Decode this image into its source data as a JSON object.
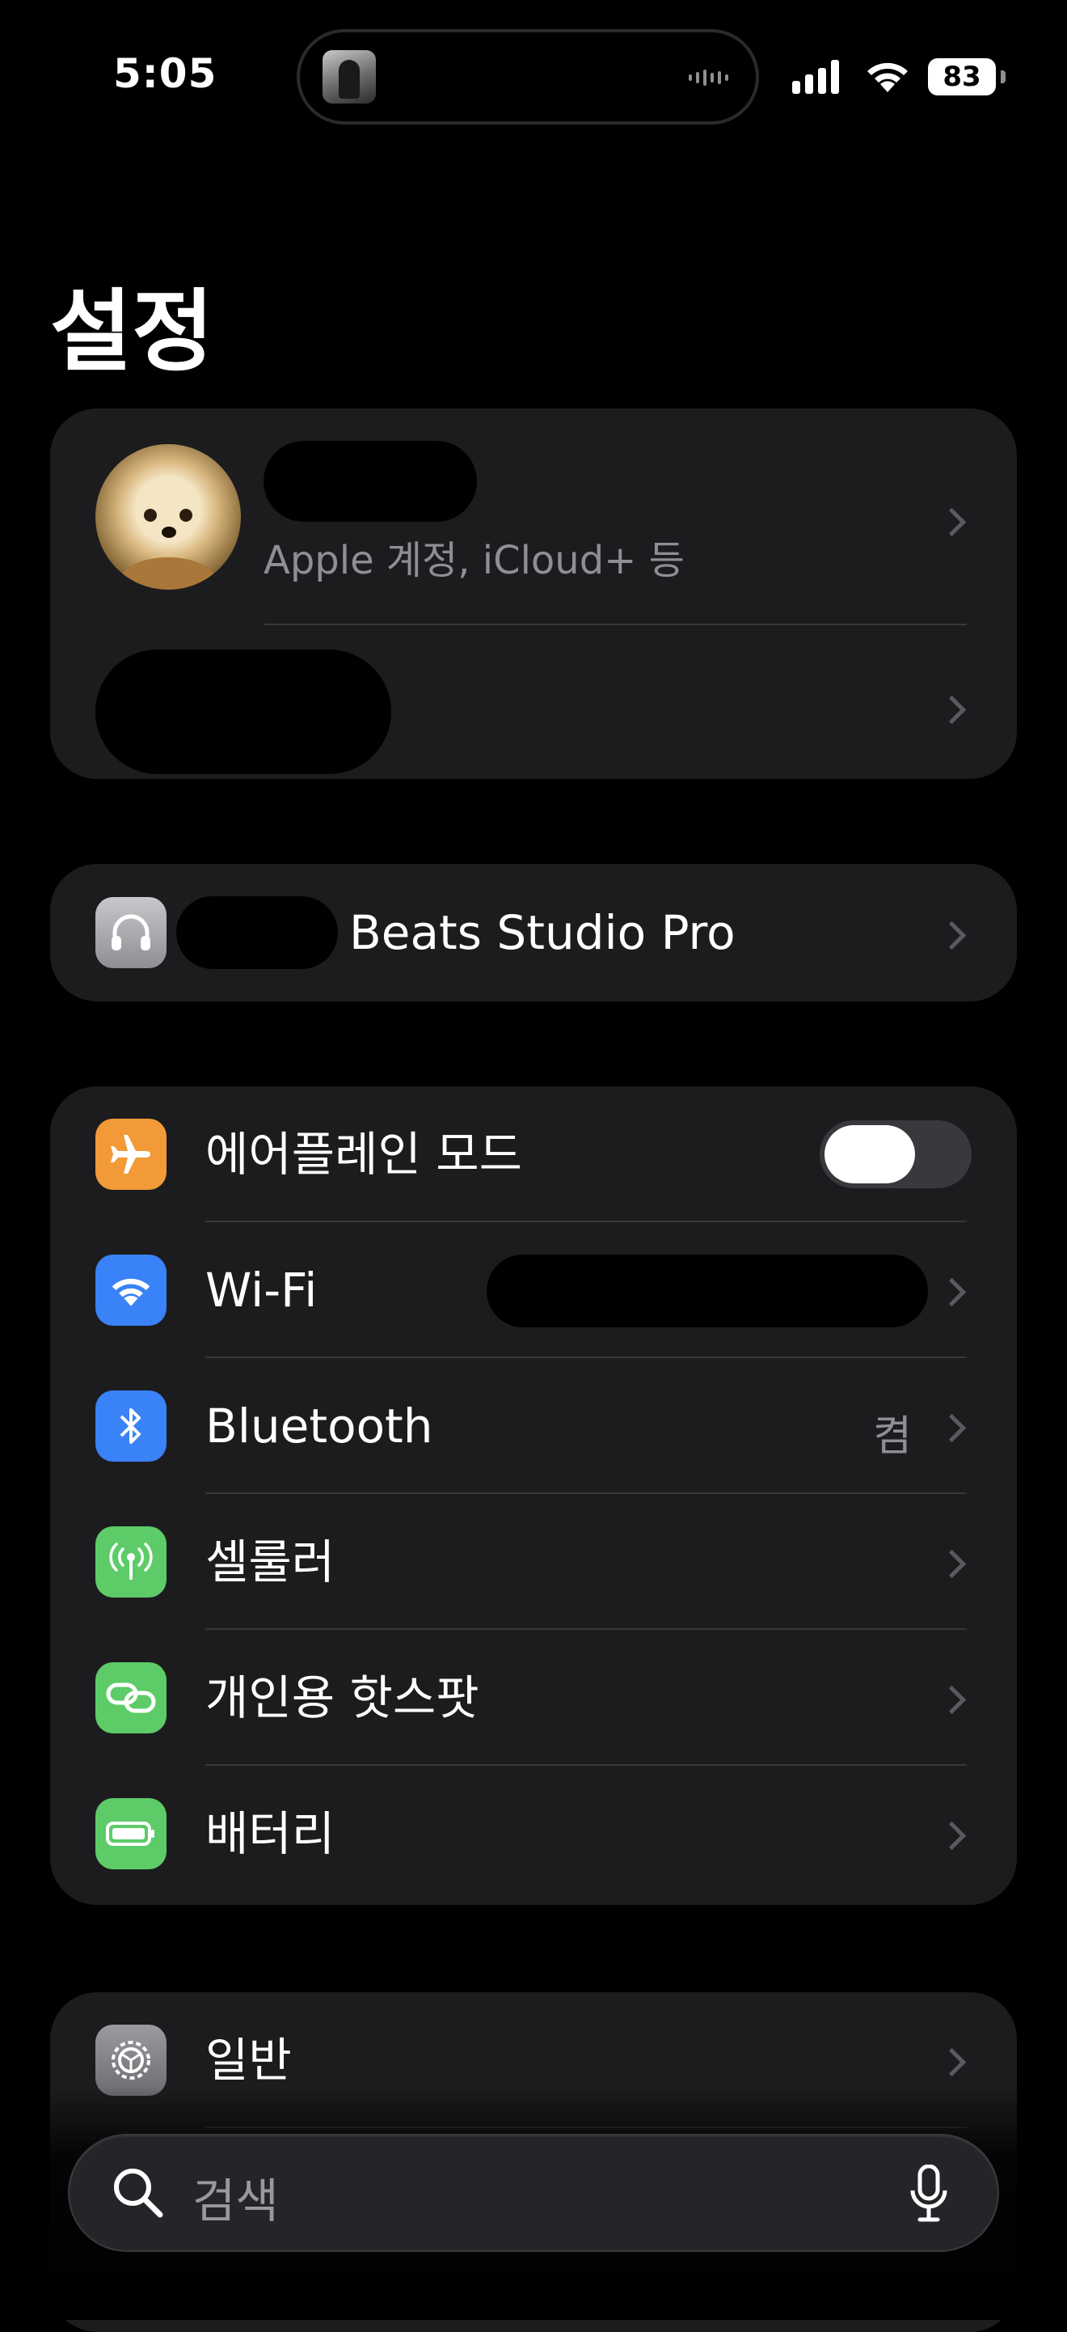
{
  "status_bar": {
    "time": "5:05",
    "battery": "83"
  },
  "page": {
    "title": "설정"
  },
  "account": {
    "subtitle": "Apple 계정, iCloud+ 등"
  },
  "device": {
    "name": "Beats Studio Pro",
    "icon": "headphones-icon"
  },
  "connectivity": [
    {
      "label": "에어플레인 모드",
      "icon": "airplane-icon",
      "color": "#f19a37",
      "toggle": false
    },
    {
      "label": "Wi-Fi",
      "icon": "wifi-icon",
      "color": "#3a82f7"
    },
    {
      "label": "Bluetooth",
      "value": "켬",
      "icon": "bluetooth-icon",
      "color": "#3a82f7"
    },
    {
      "label": "셀룰러",
      "icon": "cellular-icon",
      "color": "#5dcc68"
    },
    {
      "label": "개인용 핫스팟",
      "icon": "hotspot-icon",
      "color": "#5dcc68"
    },
    {
      "label": "배터리",
      "icon": "battery-icon",
      "color": "#5dcc68"
    }
  ],
  "general": [
    {
      "label": "일반",
      "icon": "gear-icon",
      "color": "#8e8e93"
    }
  ],
  "search": {
    "placeholder": "검색"
  }
}
